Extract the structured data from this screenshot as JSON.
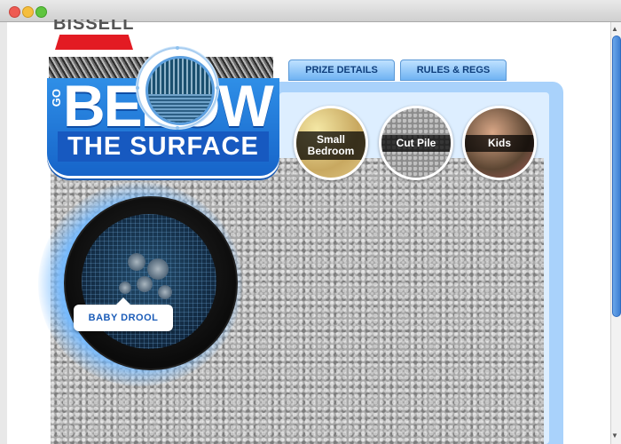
{
  "window": {
    "controls": [
      "close",
      "minimize",
      "zoom"
    ]
  },
  "brand": {
    "logo_text": "BISSELL",
    "red_bar_color": "#e31b23"
  },
  "nav": {
    "tabs": [
      {
        "label": "PRIZE DETAILS"
      },
      {
        "label": "RULES & REGS"
      }
    ]
  },
  "hero": {
    "line_go": "GO",
    "line_below": "BELOW",
    "line_surface": "THE SURFACE",
    "accent_color": "#1f72d8"
  },
  "categories": [
    {
      "label": "Small Bedroom"
    },
    {
      "label": "Cut Pile"
    },
    {
      "label": "Kids"
    }
  ],
  "scope": {
    "label": "BABY DROOL"
  },
  "scrollbar": {
    "thumb_color": "#3d7fd3"
  }
}
